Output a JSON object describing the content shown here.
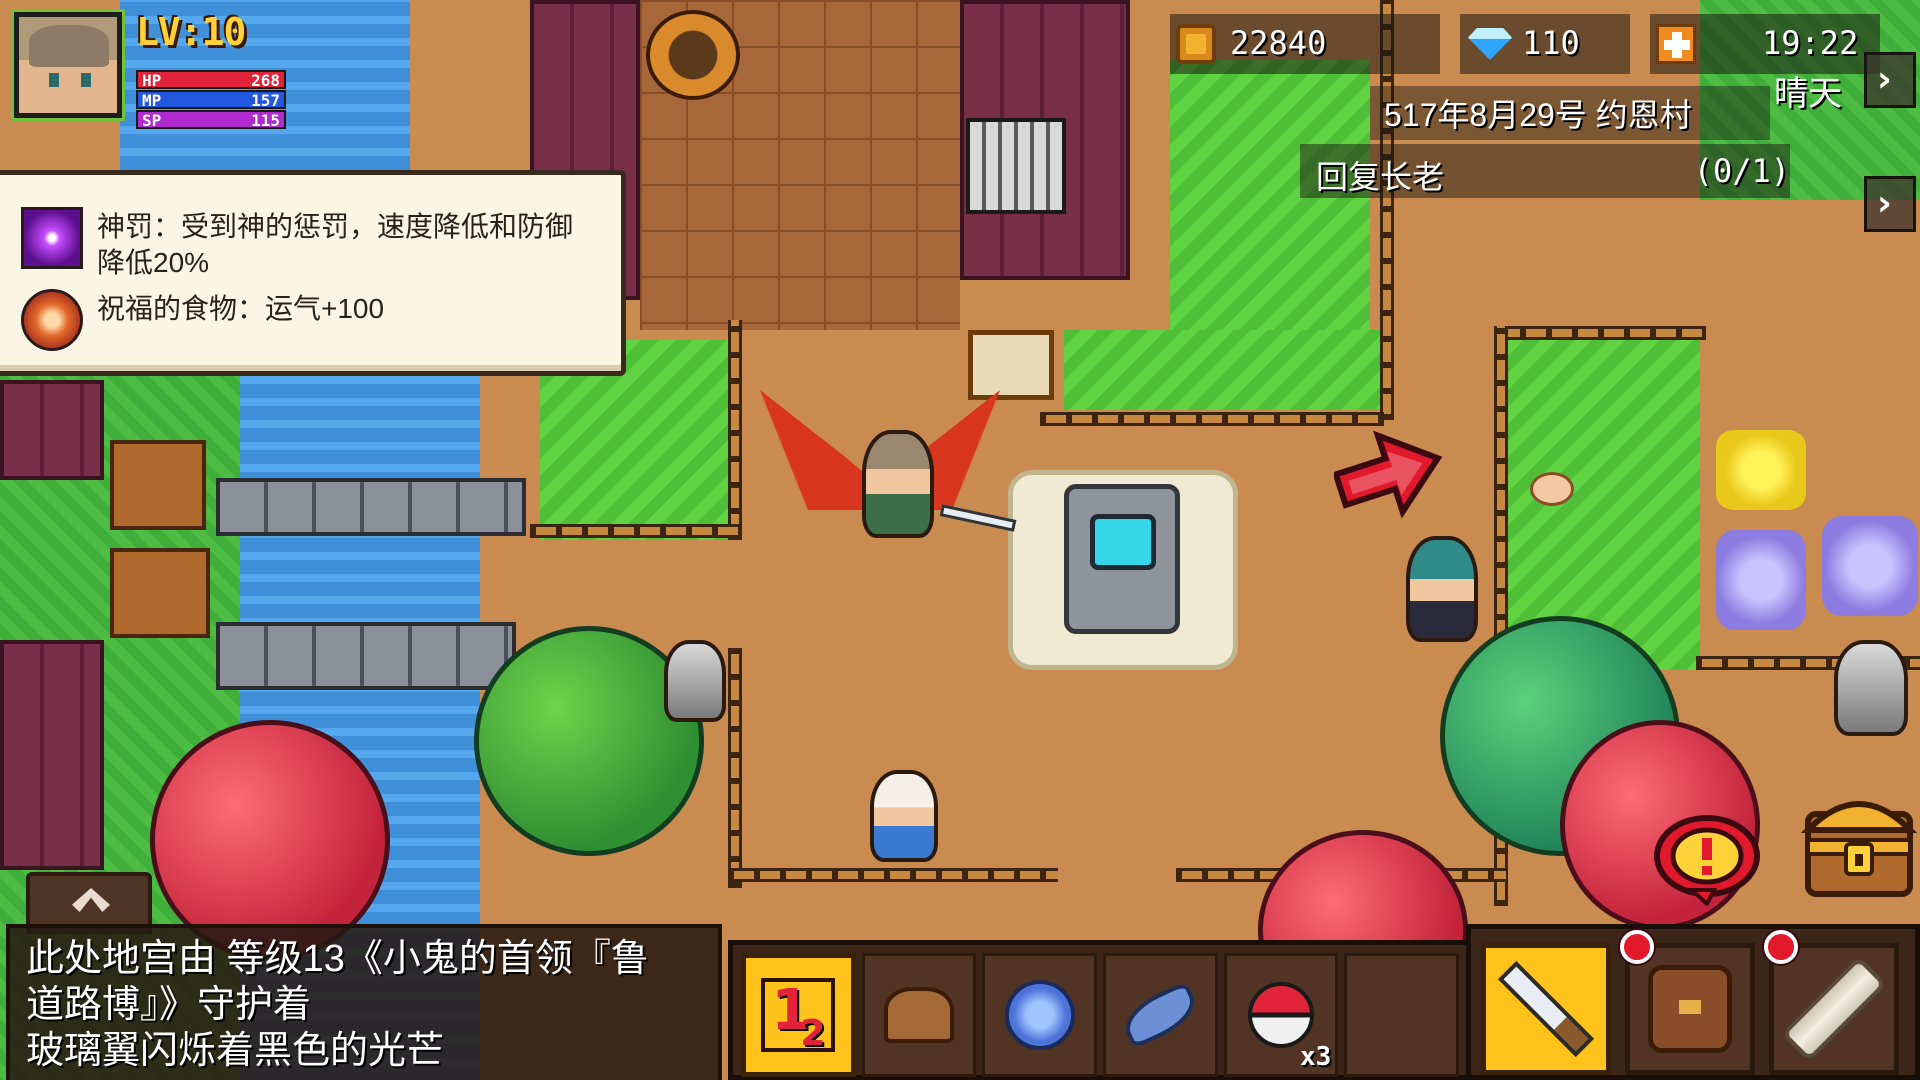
{
  "player": {
    "level_label": "LV:10",
    "hp_label": "HP",
    "hp_value": "268",
    "mp_label": "MP",
    "mp_value": "157",
    "sp_label": "SP",
    "sp_value": "115"
  },
  "effects": [
    {
      "icon": "divine-punishment-icon",
      "text": "神罚：受到神的惩罚，速度降低和防御降低20%"
    },
    {
      "icon": "blessed-food-icon",
      "text": "祝福的食物：运气+100"
    }
  ],
  "status": {
    "gold": "22840",
    "gems": "110",
    "time": "19:22",
    "weather": "晴天",
    "date_location": "517年8月29号 约恩村",
    "quest_name": "回复长老",
    "quest_progress": "(0/1)"
  },
  "message": {
    "lines": [
      "此处地宫由 等级13《小鬼的首领『鲁",
      "道路博』》守护着",
      "玻璃翼闪烁着黑色的光芒"
    ]
  },
  "hotbar": {
    "slots": [
      {
        "icon": "skill-swap-icon"
      },
      {
        "icon": "hat-icon"
      },
      {
        "icon": "magic-seal-icon"
      },
      {
        "icon": "feather-icon"
      },
      {
        "icon": "capture-ball-icon",
        "count": "x3"
      },
      {
        "icon": ""
      }
    ]
  },
  "actions": {
    "attack": {
      "icon": "sword-icon"
    },
    "bag": {
      "icon": "backpack-icon",
      "has_badge": true
    },
    "scroll": {
      "icon": "scroll-icon",
      "has_badge": true
    }
  },
  "colors": {
    "hp": "#e2243a",
    "mp": "#2257e0",
    "sp": "#b02ad0",
    "level": "#ffd23a",
    "hotbar_active": "#ffc31c",
    "badge": "#e2182c"
  }
}
